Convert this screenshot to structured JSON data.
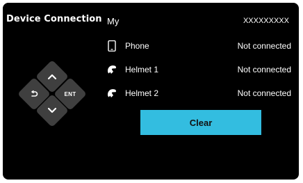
{
  "header": {
    "title": "Device Connection",
    "my_label": "My",
    "my_value": "XXXXXXXXX"
  },
  "devices": [
    {
      "icon": "phone-icon",
      "name": "Phone",
      "status": "Not connected"
    },
    {
      "icon": "helmet-icon",
      "name": "Helmet 1",
      "status": "Not connected"
    },
    {
      "icon": "helmet-icon",
      "name": "Helmet 2",
      "status": "Not connected"
    }
  ],
  "clear_button": {
    "label": "Clear"
  },
  "dpad": {
    "enter_label": "ENT"
  },
  "colors": {
    "background": "#000000",
    "text": "#ffffff",
    "accent": "#33bde0",
    "dpad": "#3f3f3f"
  }
}
